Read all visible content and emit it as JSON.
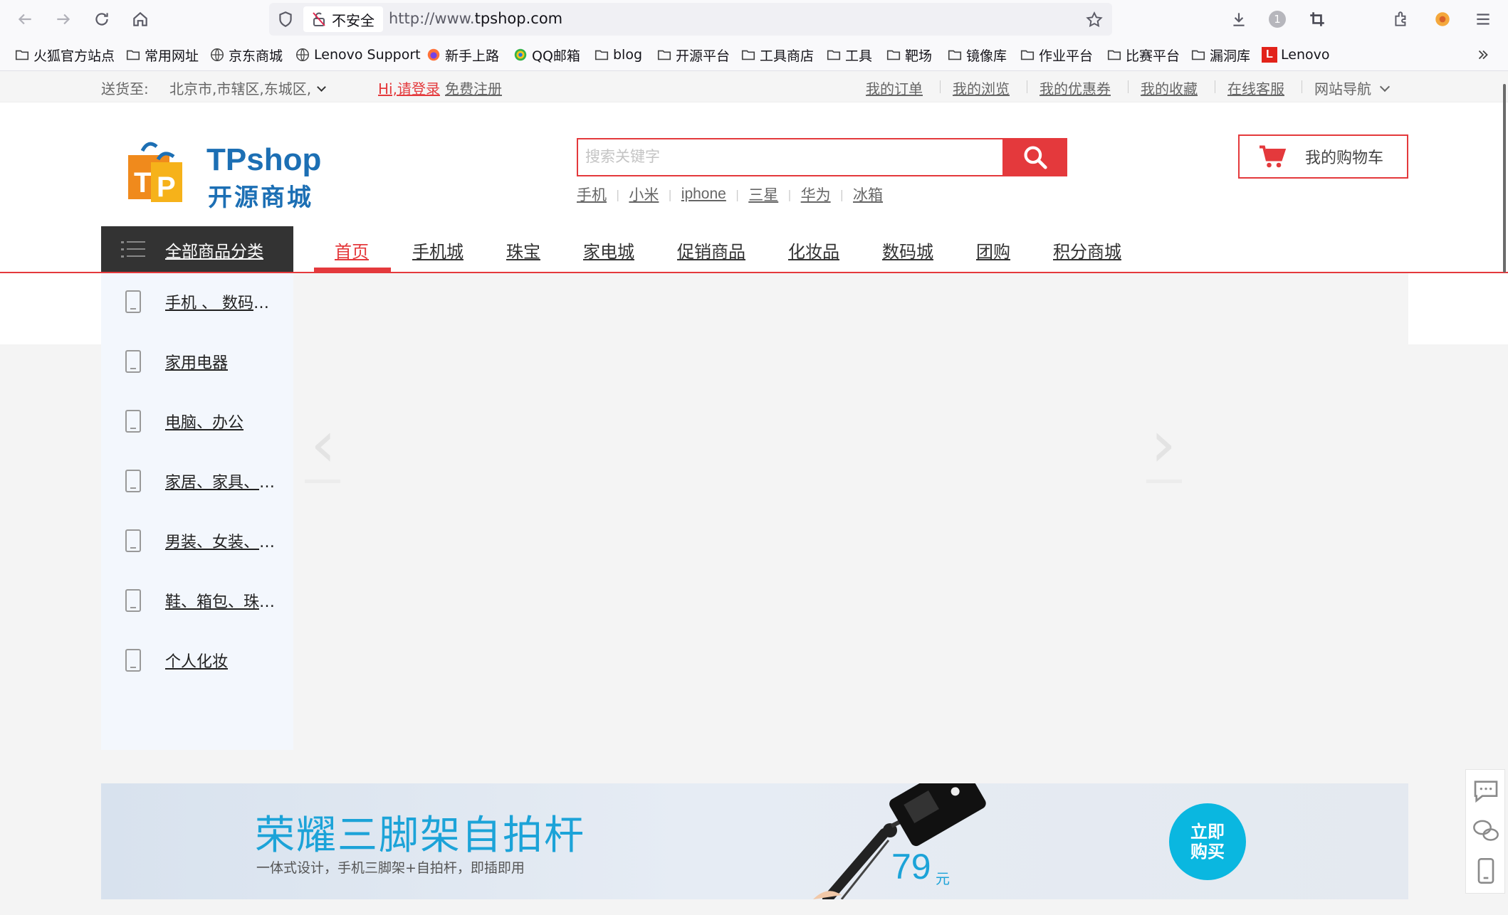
{
  "browser": {
    "url_insecure_label": "不安全",
    "url_prefix": "http://www.",
    "url_domain": "tpshop.com",
    "badge_count": "1"
  },
  "bookmarks": [
    {
      "label": "火狐官方站点",
      "icon": "folder-icon"
    },
    {
      "label": "常用网址",
      "icon": "folder-icon"
    },
    {
      "label": "京东商城",
      "icon": "globe-icon"
    },
    {
      "label": "Lenovo Support",
      "icon": "globe-icon"
    },
    {
      "label": "新手上路",
      "icon": "firefox-icon"
    },
    {
      "label": "QQ邮箱",
      "icon": "qqmail-icon"
    },
    {
      "label": "blog",
      "icon": "folder-icon"
    },
    {
      "label": "开源平台",
      "icon": "folder-icon"
    },
    {
      "label": "工具商店",
      "icon": "folder-icon"
    },
    {
      "label": "工具",
      "icon": "folder-icon"
    },
    {
      "label": "靶场",
      "icon": "folder-icon"
    },
    {
      "label": "镜像库",
      "icon": "folder-icon"
    },
    {
      "label": "作业平台",
      "icon": "folder-icon"
    },
    {
      "label": "比赛平台",
      "icon": "folder-icon"
    },
    {
      "label": "漏洞库",
      "icon": "folder-icon"
    },
    {
      "label": "Lenovo",
      "icon": "lenovo-icon"
    }
  ],
  "topbar": {
    "ship_to_label": "送货至:",
    "location": "北京市,市辖区,东城区,",
    "login": "Hi,请登录",
    "register": "免费注册",
    "links": [
      "我的订单",
      "我的浏览",
      "我的优惠券",
      "我的收藏",
      "在线客服"
    ],
    "site_nav": "网站导航"
  },
  "header": {
    "logo_text": "TPshop",
    "logo_sub": "开源商城",
    "search_placeholder": "搜索关键字",
    "hot_words": [
      "手机",
      "小米",
      "iphone",
      "三星",
      "华为",
      "冰箱"
    ],
    "cart_label": "我的购物车"
  },
  "nav": {
    "all_categories": "全部商品分类",
    "items": [
      "首页",
      "手机城",
      "珠宝",
      "家电城",
      "促销商品",
      "化妆品",
      "数码城",
      "团购",
      "积分商城"
    ]
  },
  "categories": [
    "手机 、 数码、通讯",
    "家用电器",
    "电脑、办公",
    "家居、家具、家装、厨具",
    "男装、女装、童装、内衣",
    "鞋、箱包、珠宝、手表",
    "个人化妆"
  ],
  "banner": {
    "title": "荣耀三脚架自拍杆",
    "subtitle": "一体式设计，手机三脚架+自拍杆，即插即用",
    "price": "79",
    "price_unit": "元",
    "buy_line1": "立即",
    "buy_line2": "购买"
  },
  "colors": {
    "accent": "#e4393c",
    "banner_accent": "#1ca3d8",
    "dark_nav": "#333333"
  }
}
